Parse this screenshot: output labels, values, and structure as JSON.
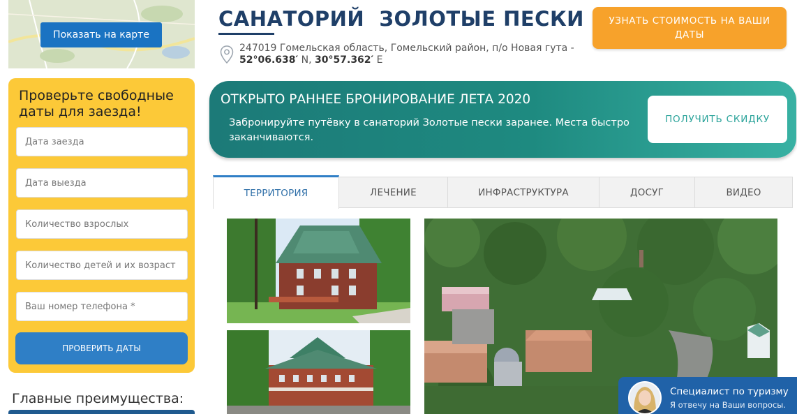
{
  "map": {
    "show_map_label": "Показать на карте"
  },
  "booking": {
    "title": "Проверьте свободные даты для заезда!",
    "fields": [
      {
        "placeholder": "Дата заезда"
      },
      {
        "placeholder": "Дата выезда"
      },
      {
        "placeholder": "Количество взрослых"
      },
      {
        "placeholder": "Количество детей и их возраст"
      },
      {
        "placeholder": "Ваш номер телефона *"
      }
    ],
    "submit_label": "ПРОВЕРИТЬ ДАТЫ"
  },
  "advantages": {
    "title": "Главные преимущества:"
  },
  "header": {
    "title": "САНАТОРИЙ  ЗОЛОТЫЕ ПЕСКИ",
    "address_text": "247019 Гомельская область, Гомельский район, п/о Новая гута - ",
    "lat": "52°06.638′",
    "lat_dir": " N, ",
    "lon": "30°57.362′",
    "lon_dir": " E",
    "price_button": "УЗНАТЬ СТОИМОСТЬ НА ВАШИ ДАТЫ"
  },
  "promo": {
    "title": "ОТКРЫТО РАННЕЕ БРОНИРОВАНИЕ ЛЕТА 2020",
    "text": "Забронируйте путёвку в санаторий Золотые пески заранее. Места быстро заканчиваются.",
    "button": "ПОЛУЧИТЬ СКИДКУ"
  },
  "tabs": [
    {
      "label": "ТЕРРИТОРИЯ",
      "active": true
    },
    {
      "label": "ЛЕЧЕНИЕ",
      "active": false
    },
    {
      "label": "ИНФРАСТРУКТУРА",
      "active": false
    },
    {
      "label": "ДОСУГ",
      "active": false
    },
    {
      "label": "ВИДЕО",
      "active": false
    }
  ],
  "chat": {
    "name": "Специалист по туризму",
    "subtitle": "Я отвечу на Ваши вопросы."
  },
  "colors": {
    "primary_blue": "#2f7fc6",
    "title_navy": "#1f3f68",
    "booking_yellow": "#fcc938",
    "price_orange": "#f7a22b",
    "promo_teal": "#1e8a80"
  }
}
